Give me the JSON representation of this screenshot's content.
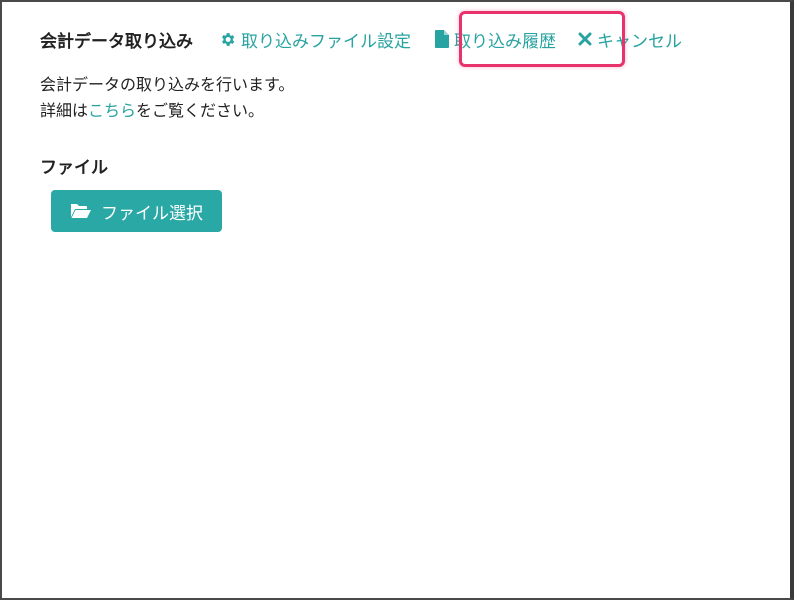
{
  "header": {
    "title": "会計データ取り込み",
    "links": {
      "settings": {
        "label": "取り込みファイル設定",
        "icon": "gear-icon"
      },
      "history": {
        "label": "取り込み履歴",
        "icon": "file-icon"
      },
      "cancel": {
        "label": "キャンセル",
        "icon": "close-icon"
      }
    }
  },
  "description": {
    "line1": "会計データの取り込みを行います。",
    "line2_prefix": "詳細は",
    "line2_link": "こちら",
    "line2_suffix": "をご覧ください。"
  },
  "file_section": {
    "label": "ファイル",
    "button_label": "ファイル選択",
    "button_icon": "folder-open-icon"
  },
  "colors": {
    "accent": "#27a3a1",
    "button": "#2aa8a6",
    "highlight": "#e8326b"
  }
}
